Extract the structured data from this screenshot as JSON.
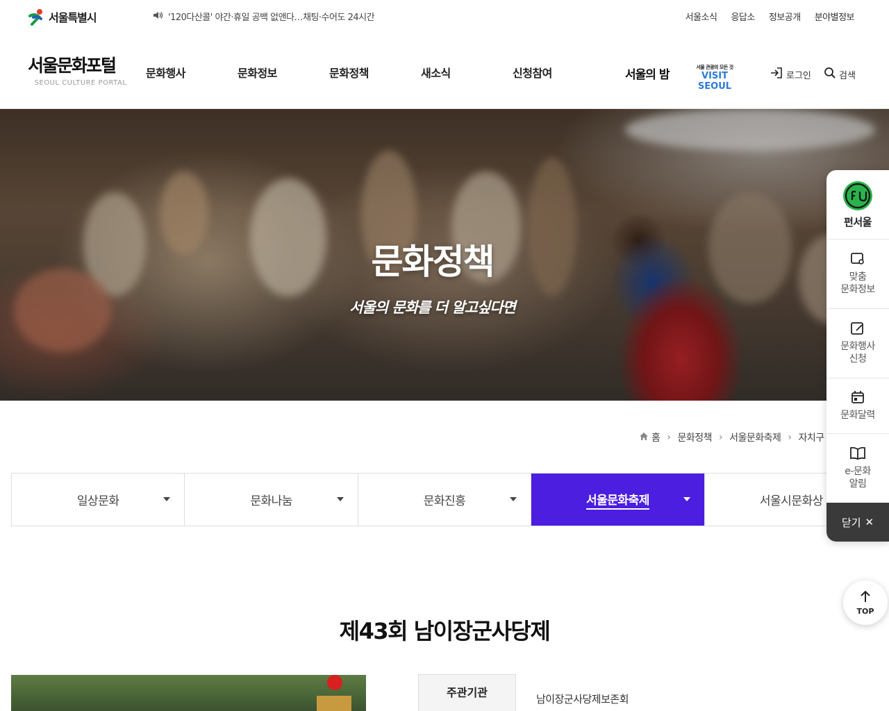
{
  "top": {
    "seoul_logo": "서울특별시",
    "notice": "'120다산콜' 야간·휴일 공백 없앤다…채팅·수어도 24시간",
    "util_links": [
      "서울소식",
      "응답소",
      "정보공개",
      "분야별정보"
    ]
  },
  "header": {
    "brand_name": "서울문화포털",
    "brand_sub": "SEOUL CULTURE PORTAL",
    "gnb": [
      "문화행사",
      "문화정보",
      "문화정책",
      "새소식",
      "신청참여"
    ],
    "night": "서울의 밤",
    "visit_small": "서울 관광의 모든 것",
    "visit_big": "VISIT SEOUL",
    "login": "로그인",
    "search": "검색"
  },
  "hero": {
    "title": "문화정책",
    "subtitle": "서울의 문화를 더 알고싶다면"
  },
  "breadcrumb": [
    "홈",
    "문화정책",
    "서울문화축제",
    "자치구"
  ],
  "subtabs": [
    {
      "label": "일상문화",
      "active": false
    },
    {
      "label": "문화나눔",
      "active": false
    },
    {
      "label": "문화진흥",
      "active": false
    },
    {
      "label": "서울문화축제",
      "active": true
    },
    {
      "label": "서울시문화상",
      "active": false
    }
  ],
  "event": {
    "title": "제43회 남이장군사당제",
    "info_label": "주관기관",
    "info_value": "남이장군사당제보존회"
  },
  "quick_menu": {
    "items": [
      "펀서울",
      "맞춤\n문화정보",
      "문화행사\n신청",
      "문화달력",
      "e-문화\n알림"
    ],
    "close": "닫기",
    "top": "TOP"
  },
  "colors": {
    "accent": "#4b1ee0",
    "visit_seoul": "#2b7bd6",
    "fun_seoul_green": "#2bb24c"
  }
}
